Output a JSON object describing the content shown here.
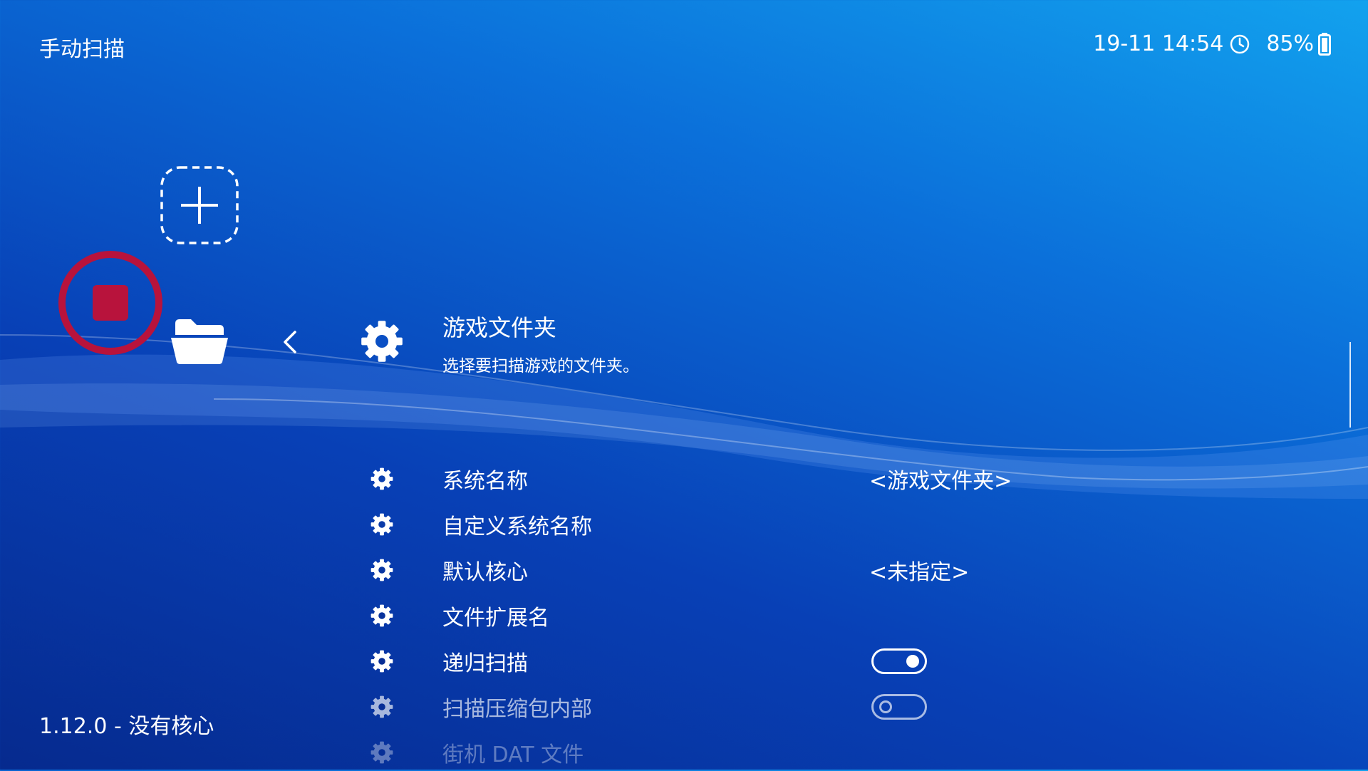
{
  "header": {
    "title": "手动扫描",
    "date_time": "19-11 14:54",
    "battery": "85%",
    "clock_icon": "clock-icon",
    "battery_icon": "battery-icon"
  },
  "tabs": [
    {
      "name": "add-content",
      "icon": "plus-icon"
    },
    {
      "name": "main-menu",
      "icon": "stop-icon",
      "selected": true
    },
    {
      "name": "load-content",
      "icon": "folder-icon"
    }
  ],
  "section": {
    "title": "游戏文件夹",
    "subtitle": "选择要扫描游戏的文件夹。",
    "icon": "gear-icon",
    "back_icon": "chevron-left-icon"
  },
  "menu": {
    "items": [
      {
        "label": "系统名称",
        "value": "<游戏文件夹>"
      },
      {
        "label": "自定义系统名称",
        "value": ""
      },
      {
        "label": "默认核心",
        "value": "<未指定>"
      },
      {
        "label": "文件扩展名",
        "value": ""
      },
      {
        "label": "递归扫描",
        "toggle": true
      },
      {
        "label": "扫描压缩包内部",
        "toggle": false
      },
      {
        "label": "街机 DAT 文件",
        "value": ""
      }
    ]
  },
  "footer": {
    "version": "1.12.0 - 没有核心"
  },
  "colors": {
    "accent_red": "#b8133c",
    "background_top": "#12a2ee",
    "background_bottom": "#062a8e",
    "text": "#ffffff"
  }
}
